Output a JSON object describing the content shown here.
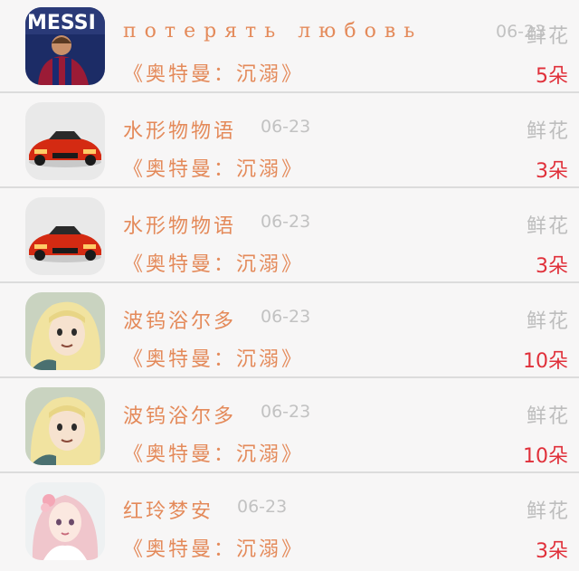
{
  "rows": [
    {
      "name": "потерять любовь",
      "date": "06-23",
      "gift": "鲜花",
      "novel": "《奥特曼：沉溺》",
      "count": "5朵",
      "avatar": "messi-avatar"
    },
    {
      "name": "水形物物语",
      "date": "06-23",
      "gift": "鲜花",
      "novel": "《奥特曼：沉溺》",
      "count": "3朵",
      "avatar": "red-car-avatar"
    },
    {
      "name": "水形物物语",
      "date": "06-23",
      "gift": "鲜花",
      "novel": "《奥特曼：沉溺》",
      "count": "3朵",
      "avatar": "red-car-avatar"
    },
    {
      "name": "波钨浴尔多",
      "date": "06-23",
      "gift": "鲜花",
      "novel": "《奥特曼：沉溺》",
      "count": "10朵",
      "avatar": "anime-blonde-avatar"
    },
    {
      "name": "波钨浴尔多",
      "date": "06-23",
      "gift": "鲜花",
      "novel": "《奥特曼：沉溺》",
      "count": "10朵",
      "avatar": "anime-blonde-avatar"
    },
    {
      "name": "红玲梦安",
      "date": "06-23",
      "gift": "鲜花",
      "novel": "《奥特曼：沉溺》",
      "count": "3朵",
      "avatar": "anime-pink-avatar"
    }
  ],
  "avatar_text": {
    "messi": "MESSI"
  },
  "colors": {
    "name": "#e48a5a",
    "count": "#e0303a",
    "muted": "#c2c2c2",
    "divider": "#dcdcdc"
  }
}
